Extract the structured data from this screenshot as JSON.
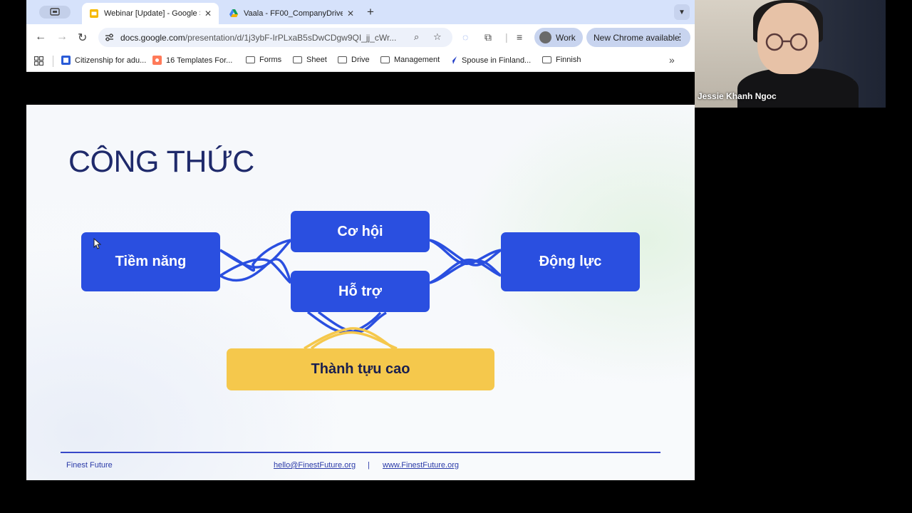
{
  "tabs": [
    {
      "title": "Webinar [Update] - Google Sl",
      "active": true,
      "favicon": "google-slides-icon"
    },
    {
      "title": "Vaala - FF00_CompanyDrive",
      "active": false,
      "favicon": "google-drive-icon"
    }
  ],
  "address_bar": {
    "host": "docs.google.com",
    "path": "/presentation/d/1j3ybF-IrPLxaB5sDwCDgw9QI_jj_cWr..."
  },
  "profile": {
    "label": "Work"
  },
  "update_button": {
    "label": "New Chrome available"
  },
  "bookmarks": [
    {
      "label": "Citizenship for adu...",
      "icon": "site-icon"
    },
    {
      "label": "16 Templates For...",
      "icon": "hubspot-icon"
    },
    {
      "label": "Forms",
      "icon": "folder-icon"
    },
    {
      "label": "Sheet",
      "icon": "folder-icon"
    },
    {
      "label": "Drive",
      "icon": "folder-icon"
    },
    {
      "label": "Management",
      "icon": "folder-icon"
    },
    {
      "label": "Spouse in Finland...",
      "icon": "site-icon"
    },
    {
      "label": "Finnish",
      "icon": "folder-icon"
    }
  ],
  "slide": {
    "title": "CÔNG THỨC",
    "boxes": {
      "tiem_nang": "Tiềm năng",
      "co_hoi": "Cơ hội",
      "ho_tro": "Hỗ trợ",
      "dong_luc": "Động lực",
      "thanh_tuu": "Thành tựu cao"
    },
    "footer": {
      "brand": "Finest Future",
      "email": "hello@FinestFuture.org",
      "divider": "|",
      "website": "www.FinestFuture.org"
    },
    "colors": {
      "box_blue": "#2a4fe0",
      "box_gold": "#f5c84c",
      "title_navy": "#1f2a6b"
    }
  },
  "webcam": {
    "name": "Jessie Khanh Ngoc"
  }
}
